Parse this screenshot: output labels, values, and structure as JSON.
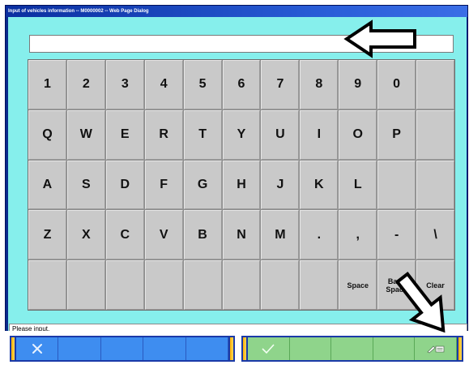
{
  "window": {
    "title": "Input of vehicles information -- M0000002 -- Web Page Dialog"
  },
  "input": {
    "value": ""
  },
  "keyboard": {
    "rows": [
      [
        "1",
        "2",
        "3",
        "4",
        "5",
        "6",
        "7",
        "8",
        "9",
        "0",
        ""
      ],
      [
        "Q",
        "W",
        "E",
        "R",
        "T",
        "Y",
        "U",
        "I",
        "O",
        "P",
        ""
      ],
      [
        "A",
        "S",
        "D",
        "F",
        "G",
        "H",
        "J",
        "K",
        "L",
        "",
        ""
      ],
      [
        "Z",
        "X",
        "C",
        "V",
        "B",
        "N",
        "M",
        ".",
        ",",
        "-",
        "\\"
      ],
      [
        "",
        "",
        "",
        "",
        "",
        "",
        "",
        "",
        "Space",
        "Back Space",
        "Clear"
      ]
    ]
  },
  "status": {
    "message": "Please input."
  },
  "toolbar": {
    "cancel_icon": "cross-icon",
    "ok_icon": "checkmark-icon",
    "edit_icon": "edit-pencil-icon"
  },
  "colors": {
    "client_bg": "#86efec",
    "key_bg": "#c9c9c9",
    "left_toolbar": "#3e8df0",
    "right_toolbar": "#8fd48b"
  }
}
